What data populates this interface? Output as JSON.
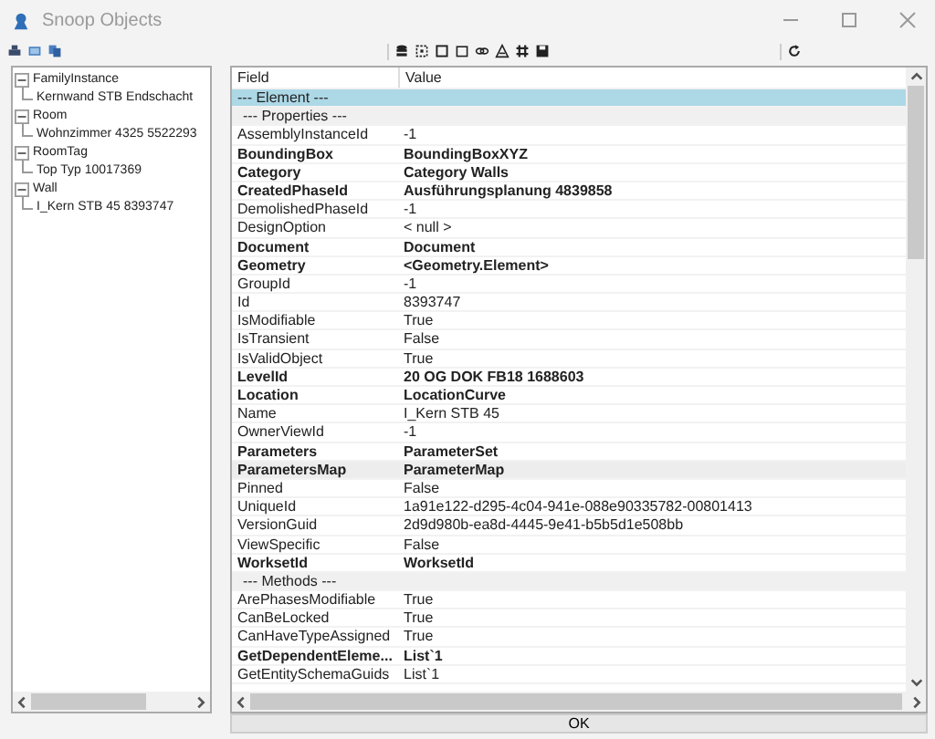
{
  "window": {
    "title": "Snoop Objects"
  },
  "tree": [
    {
      "label": "FamilyInstance",
      "expanded": true,
      "children": [
        {
          "label": "Kernwand STB Endschacht"
        }
      ]
    },
    {
      "label": "Room",
      "expanded": true,
      "children": [
        {
          "label": "Wohnzimmer 4325  5522293"
        }
      ]
    },
    {
      "label": "RoomTag",
      "expanded": true,
      "children": [
        {
          "label": "Top Typ  10017369"
        }
      ]
    },
    {
      "label": "Wall",
      "expanded": true,
      "children": [
        {
          "label": "I_Kern STB 45  8393747"
        }
      ]
    }
  ],
  "table": {
    "columns": [
      "Field",
      "Value"
    ],
    "rows": [
      {
        "kind": "section",
        "field": "--- Element ---",
        "selected": true
      },
      {
        "kind": "group",
        "field": "--- Properties ---"
      },
      {
        "kind": "field",
        "field": "AssemblyInstanceId",
        "value": "-1",
        "bold": false
      },
      {
        "kind": "field",
        "field": "BoundingBox",
        "value": "BoundingBoxXYZ",
        "bold": true
      },
      {
        "kind": "field",
        "field": "Category",
        "value": "Category  Walls",
        "bold": true
      },
      {
        "kind": "field",
        "field": "CreatedPhaseId",
        "value": "Ausführungsplanung  4839858",
        "bold": true
      },
      {
        "kind": "field",
        "field": "DemolishedPhaseId",
        "value": "-1",
        "bold": false
      },
      {
        "kind": "field",
        "field": "DesignOption",
        "value": "< null >",
        "bold": false
      },
      {
        "kind": "field",
        "field": "Document",
        "value": "Document",
        "bold": true
      },
      {
        "kind": "field",
        "field": "Geometry",
        "value": "<Geometry.Element>",
        "bold": true
      },
      {
        "kind": "field",
        "field": "GroupId",
        "value": "-1",
        "bold": false
      },
      {
        "kind": "field",
        "field": "Id",
        "value": "8393747",
        "bold": false
      },
      {
        "kind": "field",
        "field": "IsModifiable",
        "value": "True",
        "bold": false
      },
      {
        "kind": "field",
        "field": "IsTransient",
        "value": "False",
        "bold": false
      },
      {
        "kind": "field",
        "field": "IsValidObject",
        "value": "True",
        "bold": false
      },
      {
        "kind": "field",
        "field": "LevelId",
        "value": "20 OG DOK FB18  1688603",
        "bold": true
      },
      {
        "kind": "field",
        "field": "Location",
        "value": "LocationCurve",
        "bold": true
      },
      {
        "kind": "field",
        "field": "Name",
        "value": "I_Kern STB 45",
        "bold": false
      },
      {
        "kind": "field",
        "field": "OwnerViewId",
        "value": "-1",
        "bold": false
      },
      {
        "kind": "field",
        "field": "Parameters",
        "value": "ParameterSet",
        "bold": true
      },
      {
        "kind": "field",
        "field": "ParametersMap",
        "value": "ParameterMap",
        "bold": true,
        "hovered": true
      },
      {
        "kind": "field",
        "field": "Pinned",
        "value": "False",
        "bold": false
      },
      {
        "kind": "field",
        "field": "UniqueId",
        "value": "1a91e122-d295-4c04-941e-088e90335782-00801413",
        "bold": false
      },
      {
        "kind": "field",
        "field": "VersionGuid",
        "value": "2d9d980b-ea8d-4445-9e41-b5b5d1e508bb",
        "bold": false
      },
      {
        "kind": "field",
        "field": "ViewSpecific",
        "value": "False",
        "bold": false
      },
      {
        "kind": "field",
        "field": "WorksetId",
        "value": "WorksetId",
        "bold": true
      },
      {
        "kind": "group",
        "field": "--- Methods ---"
      },
      {
        "kind": "field",
        "field": "ArePhasesModifiable",
        "value": "True",
        "bold": false
      },
      {
        "kind": "field",
        "field": "CanBeLocked",
        "value": "True",
        "bold": false
      },
      {
        "kind": "field",
        "field": "CanHaveTypeAssigned",
        "value": "True",
        "bold": false
      },
      {
        "kind": "field",
        "field": "GetDependentEleme...",
        "value": "List`1",
        "bold": true
      },
      {
        "kind": "field",
        "field": "GetEntitySchemaGuids",
        "value": "List`1",
        "bold": false
      }
    ]
  },
  "buttons": [
    "OK"
  ]
}
